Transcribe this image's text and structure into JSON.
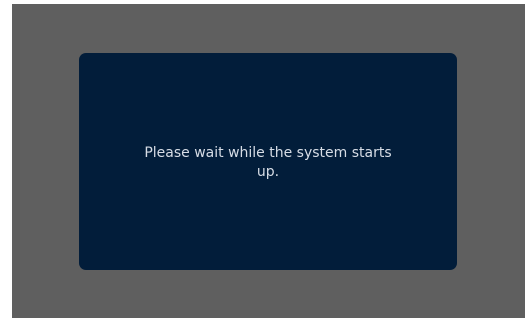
{
  "dialog": {
    "message": "Please wait while the system starts up."
  },
  "colors": {
    "screen_background": "#5f5f5f",
    "dialog_background": "#021d3a",
    "message_text": "#d7dde6"
  }
}
